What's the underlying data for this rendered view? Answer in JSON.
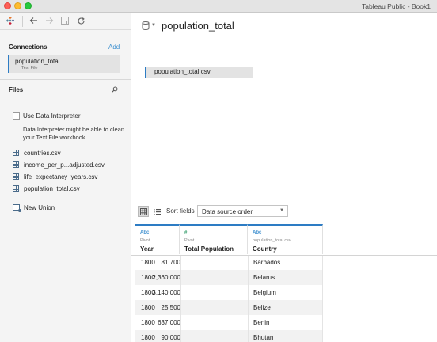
{
  "window": {
    "title": "Tableau Public - Book1"
  },
  "sidebar": {
    "connections_title": "Connections",
    "add_label": "Add",
    "connection": {
      "name": "population_total",
      "type": "Text File"
    },
    "files_title": "Files",
    "data_interpreter_label": "Use Data Interpreter",
    "data_interpreter_desc": "Data Interpreter might be able to clean your Text File workbook.",
    "files": [
      "countries.csv",
      "income_per_p...adjusted.csv",
      "life_expectancy_years.csv",
      "population_total.csv"
    ],
    "new_union_label": "New Union"
  },
  "datasource": {
    "title": "population_total",
    "canvas_table": "population_total.csv"
  },
  "grid_toolbar": {
    "sort_label": "Sort fields",
    "sort_value": "Data source order"
  },
  "grid": {
    "columns": [
      {
        "type": "Abc",
        "source": "Pivot",
        "name": "Year"
      },
      {
        "type": "#",
        "source": "Pivot",
        "name": "Total Population"
      },
      {
        "type": "Abc",
        "source": "population_total.csv",
        "name": "Country"
      }
    ],
    "rows": [
      [
        "1800",
        "81,700",
        "Barbados"
      ],
      [
        "1800",
        "2,360,000",
        "Belarus"
      ],
      [
        "1800",
        "3,140,000",
        "Belgium"
      ],
      [
        "1800",
        "25,500",
        "Belize"
      ],
      [
        "1800",
        "637,000",
        "Benin"
      ],
      [
        "1800",
        "90,000",
        "Bhutan"
      ]
    ]
  },
  "colors": {
    "accent": "#2d7cc4",
    "link": "#3d8fcf"
  },
  "icons": [
    "tableau-logo-icon",
    "back-arrow-icon",
    "forward-arrow-icon",
    "save-icon",
    "refresh-icon",
    "search-icon",
    "database-icon",
    "grid-view-icon",
    "list-view-icon"
  ]
}
